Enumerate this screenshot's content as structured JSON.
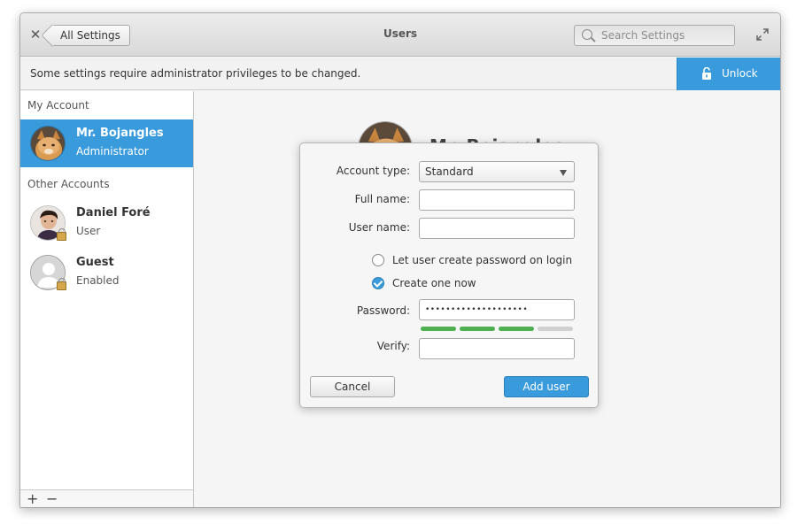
{
  "window": {
    "title": "Users",
    "back_label": "All Settings",
    "search_placeholder": "Search Settings"
  },
  "infobar": {
    "message": "Some settings require administrator privileges to be changed.",
    "unlock_label": "Unlock"
  },
  "sidebar": {
    "my_account_header": "My Account",
    "other_accounts_header": "Other Accounts",
    "current_user": {
      "name": "Mr. Bojangles",
      "role": "Administrator"
    },
    "others": [
      {
        "name": "Daniel Foré",
        "role": "User"
      },
      {
        "name": "Guest",
        "role": "Enabled"
      }
    ],
    "add_symbol": "+",
    "remove_symbol": "−"
  },
  "background": {
    "name_fragment": "Mr. Bojangles"
  },
  "dialog": {
    "account_type_label": "Account type:",
    "account_type_value": "Standard",
    "full_name_label": "Full name:",
    "full_name_value": "",
    "user_name_label": "User name:",
    "user_name_value": "",
    "option_login": "Let user create password on login",
    "option_now": "Create one now",
    "password_label": "Password:",
    "password_value": "••••••••••••••••••••",
    "verify_label": "Verify:",
    "verify_value": "",
    "password_strength": {
      "filled_segments": 3,
      "total_segments": 4
    },
    "cancel_label": "Cancel",
    "add_label": "Add user"
  },
  "colors": {
    "accent": "#3a9bdc",
    "strength_good": "#4caf50"
  }
}
